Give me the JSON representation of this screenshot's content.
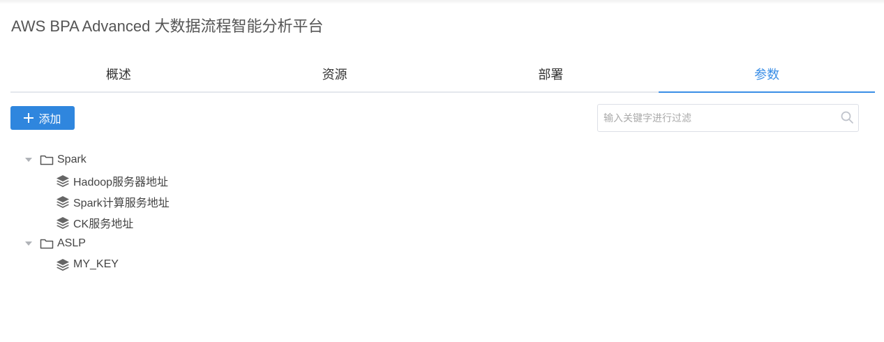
{
  "header": {
    "title": "AWS BPA Advanced 大数据流程智能分析平台"
  },
  "tabs": [
    {
      "label": "概述",
      "active": false
    },
    {
      "label": "资源",
      "active": false
    },
    {
      "label": "部署",
      "active": false
    },
    {
      "label": "参数",
      "active": true
    }
  ],
  "toolbar": {
    "add_label": "添加",
    "add_icon": "plus-icon"
  },
  "search": {
    "placeholder": "输入关键字进行过滤",
    "value": "",
    "icon": "search-icon"
  },
  "tree": [
    {
      "label": "Spark",
      "icon": "folder-icon",
      "expanded": true,
      "children": [
        {
          "label": "Hadoop服务器地址",
          "icon": "layers-icon"
        },
        {
          "label": "Spark计算服务地址",
          "icon": "layers-icon"
        },
        {
          "label": "CK服务地址",
          "icon": "layers-icon"
        }
      ]
    },
    {
      "label": "ASLP",
      "icon": "folder-icon",
      "expanded": true,
      "children": [
        {
          "label": "MY_KEY",
          "icon": "layers-icon"
        }
      ]
    }
  ],
  "colors": {
    "accent": "#3a8ee6",
    "button_bg": "#2f86de",
    "border": "#dcdfe6",
    "text": "#333333"
  }
}
